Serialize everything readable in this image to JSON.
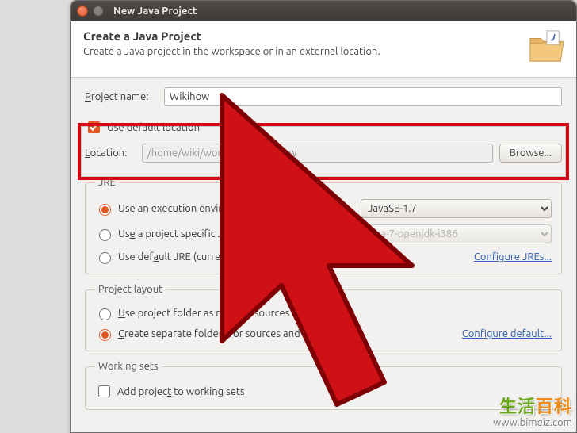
{
  "window": {
    "title": "New Java Project"
  },
  "banner": {
    "heading": "Create a Java Project",
    "sub": "Create a Java project in the workspace or in an external location."
  },
  "project_name": {
    "label": "Project name:",
    "value": "Wikihow"
  },
  "location": {
    "checkbox_label": "Use default location",
    "checked": true,
    "path_label": "Location:",
    "path_value": "/home/wiki/workspace/Wikihow",
    "browse": "Browse..."
  },
  "jre": {
    "legend": "JRE",
    "exec_env_label": "Use an execution environment JRE:",
    "exec_env_value": "JavaSE-1.7",
    "project_specific_label": "Use a project specific JRE:",
    "project_specific_value": "java-7-openjdk-i386",
    "default_jre_label": "Use default JRE (currently 'java-7-openjdk-i386')",
    "configure_link": "Configure JREs..."
  },
  "layout": {
    "legend": "Project layout",
    "root_label": "Use project folder as root for sources and class files",
    "separate_label": "Create separate folders for sources and class files",
    "configure_link": "Configure default..."
  },
  "working_sets": {
    "legend": "Working sets",
    "add_label": "Add project to working sets"
  },
  "watermark": {
    "line1_a": "生活",
    "line1_b": "百科",
    "url": "www.bimeiz.com"
  }
}
